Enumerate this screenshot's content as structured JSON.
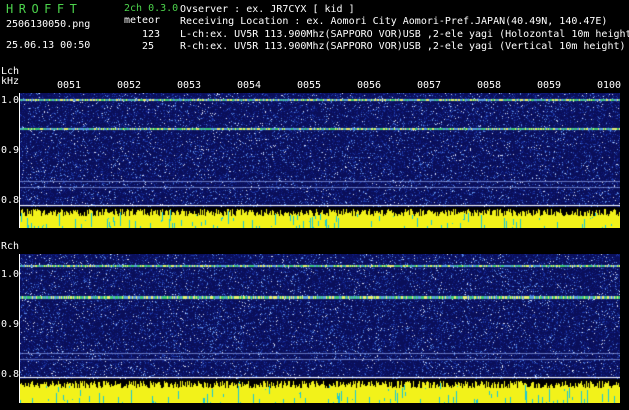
{
  "header": {
    "app_title": "HROFFT",
    "channels": "2ch 0.3.0",
    "filename": "2506130050.png",
    "meteor_label": "meteor",
    "timestamp": "25.06.13 00:50",
    "count_lch": "123",
    "count_rch": "25"
  },
  "info": {
    "observer": "Ovserver                  : ex. JR7CYX [ kid ]",
    "location": "Receiving Location : ex. Aomori City Aomori-Pref.JAPAN(40.49N, 140.47E)",
    "lch": "L-ch:ex. UV5R 113.900Mhz(SAPPORO VOR)USB ,2-ele yagi (Holozontal 10m height",
    "rch": "R-ch:ex. UV5R 113.900Mhz(SAPPORO VOR)USB ,2-ele yagi (Vertical 10m height)"
  },
  "panels": {
    "lch_label": "Lch",
    "unit_label": "kHz",
    "rch_label": "Rch",
    "y_ticks": [
      "1.0",
      "0.9",
      "0.8"
    ],
    "time_ticks": [
      "0051",
      "0052",
      "0053",
      "0054",
      "0055",
      "0056",
      "0057",
      "0058",
      "0059",
      "0100"
    ]
  },
  "colors": {
    "app_title": "#4cd34c",
    "spectrogram_bg": "#0a0f5a",
    "signal_line": "#3cc878",
    "amplitude_bar": "#f2f21a",
    "amplitude_base": "#18c8d8"
  }
}
